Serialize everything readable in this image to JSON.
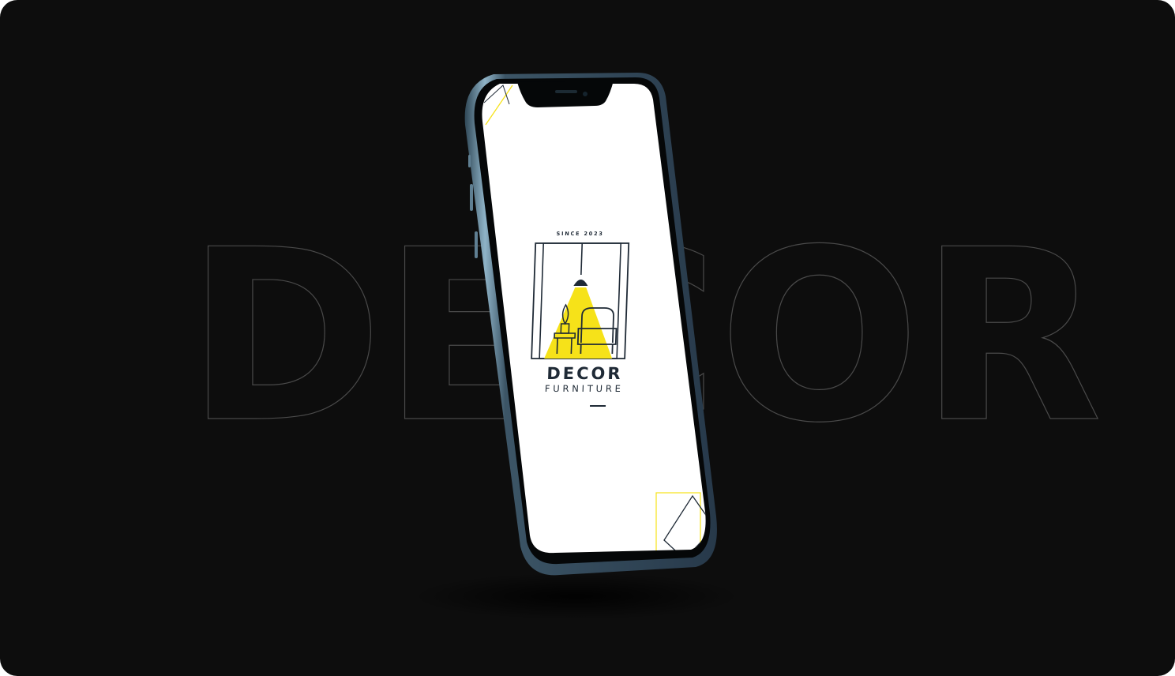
{
  "background": {
    "word": "DECOR",
    "color": "#0d0d0d",
    "outline_color": "#4a4a4a"
  },
  "phone": {
    "frame_color": "#7fa3b8",
    "screen_color": "#ffffff"
  },
  "logo": {
    "since": "SINCE 2023",
    "brand": "DECOR",
    "tagline": "FURNITURE",
    "accent": "#f6e219",
    "ink": "#1f2a36"
  }
}
